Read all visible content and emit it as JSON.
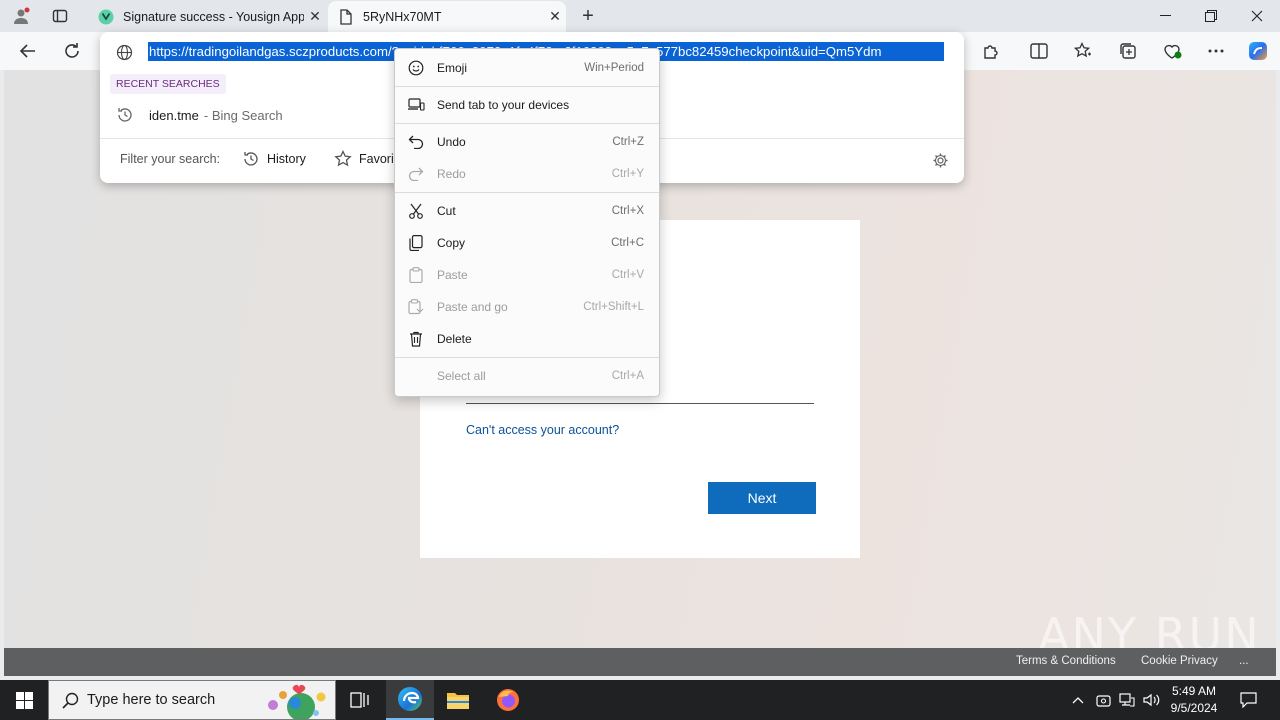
{
  "browser": {
    "tabs": [
      {
        "title": "Signature success - Yousign App"
      },
      {
        "title": "5RyNHx70MT"
      }
    ],
    "address_url": "https://tradingoilandgas.sczproducts.com/?uuid=...b4F766e8972e1fa4f72a-2f1680aa5e7e577bc82459checkpoint&uid=Qm5Ydm",
    "address_url_visible": "https://tradingoilandgas.sczproducts.com/?uuid=bf766e8972e1fa4f72a-2f16808aa5e7e577bc82459checkpoint&uid=Qm5Ydm"
  },
  "omnibox": {
    "recent_label": "RECENT SEARCHES",
    "recent_item": {
      "query": "iden.tme",
      "suffix": "- Bing Search"
    },
    "filter_label": "Filter your search:",
    "filters": [
      "History",
      "Favorites"
    ]
  },
  "context_menu": [
    {
      "label": "Emoji",
      "shortcut": "Win+Period",
      "disabled": false,
      "icon": "emoji-icon"
    },
    {
      "label": "Send tab to your devices",
      "shortcut": "",
      "disabled": false,
      "icon": "send-tab-icon"
    },
    {
      "label": "Undo",
      "shortcut": "Ctrl+Z",
      "disabled": false,
      "icon": "undo-icon"
    },
    {
      "label": "Redo",
      "shortcut": "Ctrl+Y",
      "disabled": true,
      "icon": "redo-icon"
    },
    {
      "label": "Cut",
      "shortcut": "Ctrl+X",
      "disabled": false,
      "icon": "cut-icon"
    },
    {
      "label": "Copy",
      "shortcut": "Ctrl+C",
      "disabled": false,
      "icon": "copy-icon"
    },
    {
      "label": "Paste",
      "shortcut": "Ctrl+V",
      "disabled": true,
      "icon": "paste-icon"
    },
    {
      "label": "Paste and go",
      "shortcut": "Ctrl+Shift+L",
      "disabled": true,
      "icon": "paste-go-icon"
    },
    {
      "label": "Delete",
      "shortcut": "",
      "disabled": false,
      "icon": "delete-icon"
    },
    {
      "label": "Select all",
      "shortcut": "Ctrl+A",
      "disabled": true,
      "icon": ""
    }
  ],
  "page": {
    "cant_access": "Can't access your account?",
    "next_button": "Next",
    "footer_links": [
      "Terms & Conditions",
      "Cookie Privacy",
      "..."
    ],
    "watermark": "ANY RUN"
  },
  "taskbar": {
    "search_placeholder": "Type here to search",
    "time": "5:49 AM",
    "date": "9/5/2024"
  },
  "colors": {
    "accent": "#0f6cbd",
    "selection": "#0a64d6",
    "taskbar": "#202123",
    "link": "#0a5299"
  }
}
